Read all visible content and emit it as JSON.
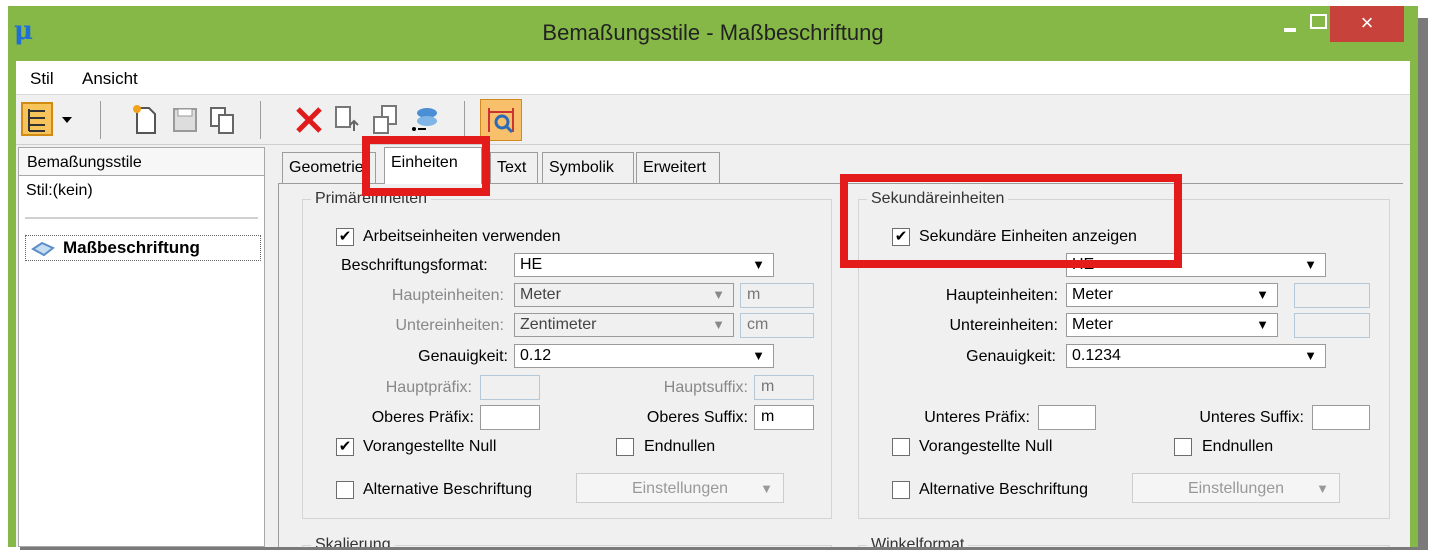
{
  "window": {
    "title": "Bemaßungsstile - Maßbeschriftung",
    "app_icon": "μ",
    "close": "×"
  },
  "menu": {
    "stil": "Stil",
    "ansicht": "Ansicht"
  },
  "left_panel": {
    "header": "Bemaßungsstile",
    "stil_label": "Stil:(kein)",
    "item": "Maßbeschriftung"
  },
  "tabs": [
    "Geometrie",
    "Einheiten",
    "Text",
    "Symbolik",
    "Erweitert"
  ],
  "primary": {
    "title": "Primäreinheiten",
    "use_work_units": "Arbeitseinheiten verwenden",
    "label_format_label": "Beschriftungsformat:",
    "label_format_value": "HE",
    "main_units_label": "Haupteinheiten:",
    "main_units_value": "Meter",
    "main_units_suffix": "m",
    "sub_units_label": "Untereinheiten:",
    "sub_units_value": "Zentimeter",
    "sub_units_suffix": "cm",
    "accuracy_label": "Genauigkeit:",
    "accuracy_value": "0.12",
    "main_prefix_label": "Hauptpräfix:",
    "main_suffix_label": "Hauptsuffix:",
    "main_suffix_value": "m",
    "upper_prefix_label": "Oberes Präfix:",
    "upper_suffix_label": "Oberes Suffix:",
    "upper_suffix_value": "m",
    "leading_zero": "Vorangestellte Null",
    "trailing_zeros": "Endnullen",
    "alt_label": "Alternative Beschriftung",
    "settings_button": "Einstellungen"
  },
  "secondary": {
    "title": "Sekundäreinheiten",
    "show_secondary": "Sekundäre Einheiten anzeigen",
    "label_format_value": "HE",
    "main_units_label": "Haupteinheiten:",
    "main_units_value": "Meter",
    "sub_units_label": "Untereinheiten:",
    "sub_units_value": "Meter",
    "accuracy_label": "Genauigkeit:",
    "accuracy_value": "0.1234",
    "lower_prefix_label": "Unteres Präfix:",
    "lower_suffix_label": "Unteres Suffix:",
    "leading_zero": "Vorangestellte Null",
    "trailing_zeros": "Endnullen",
    "alt_label": "Alternative Beschriftung",
    "settings_button": "Einstellungen"
  },
  "scaling": {
    "title": "Skalierung"
  },
  "angle": {
    "title": "Winkelformat"
  },
  "icons": [
    "view-dropdown-icon",
    "new-style-icon",
    "save-icon",
    "copy-icon",
    "delete-icon",
    "import-icon",
    "export-icon",
    "stack-icon",
    "zoom-dimension-icon"
  ],
  "colors": {
    "title_bar": "#85b847",
    "close_button": "#c8423c",
    "highlight": "#e31b1b"
  }
}
